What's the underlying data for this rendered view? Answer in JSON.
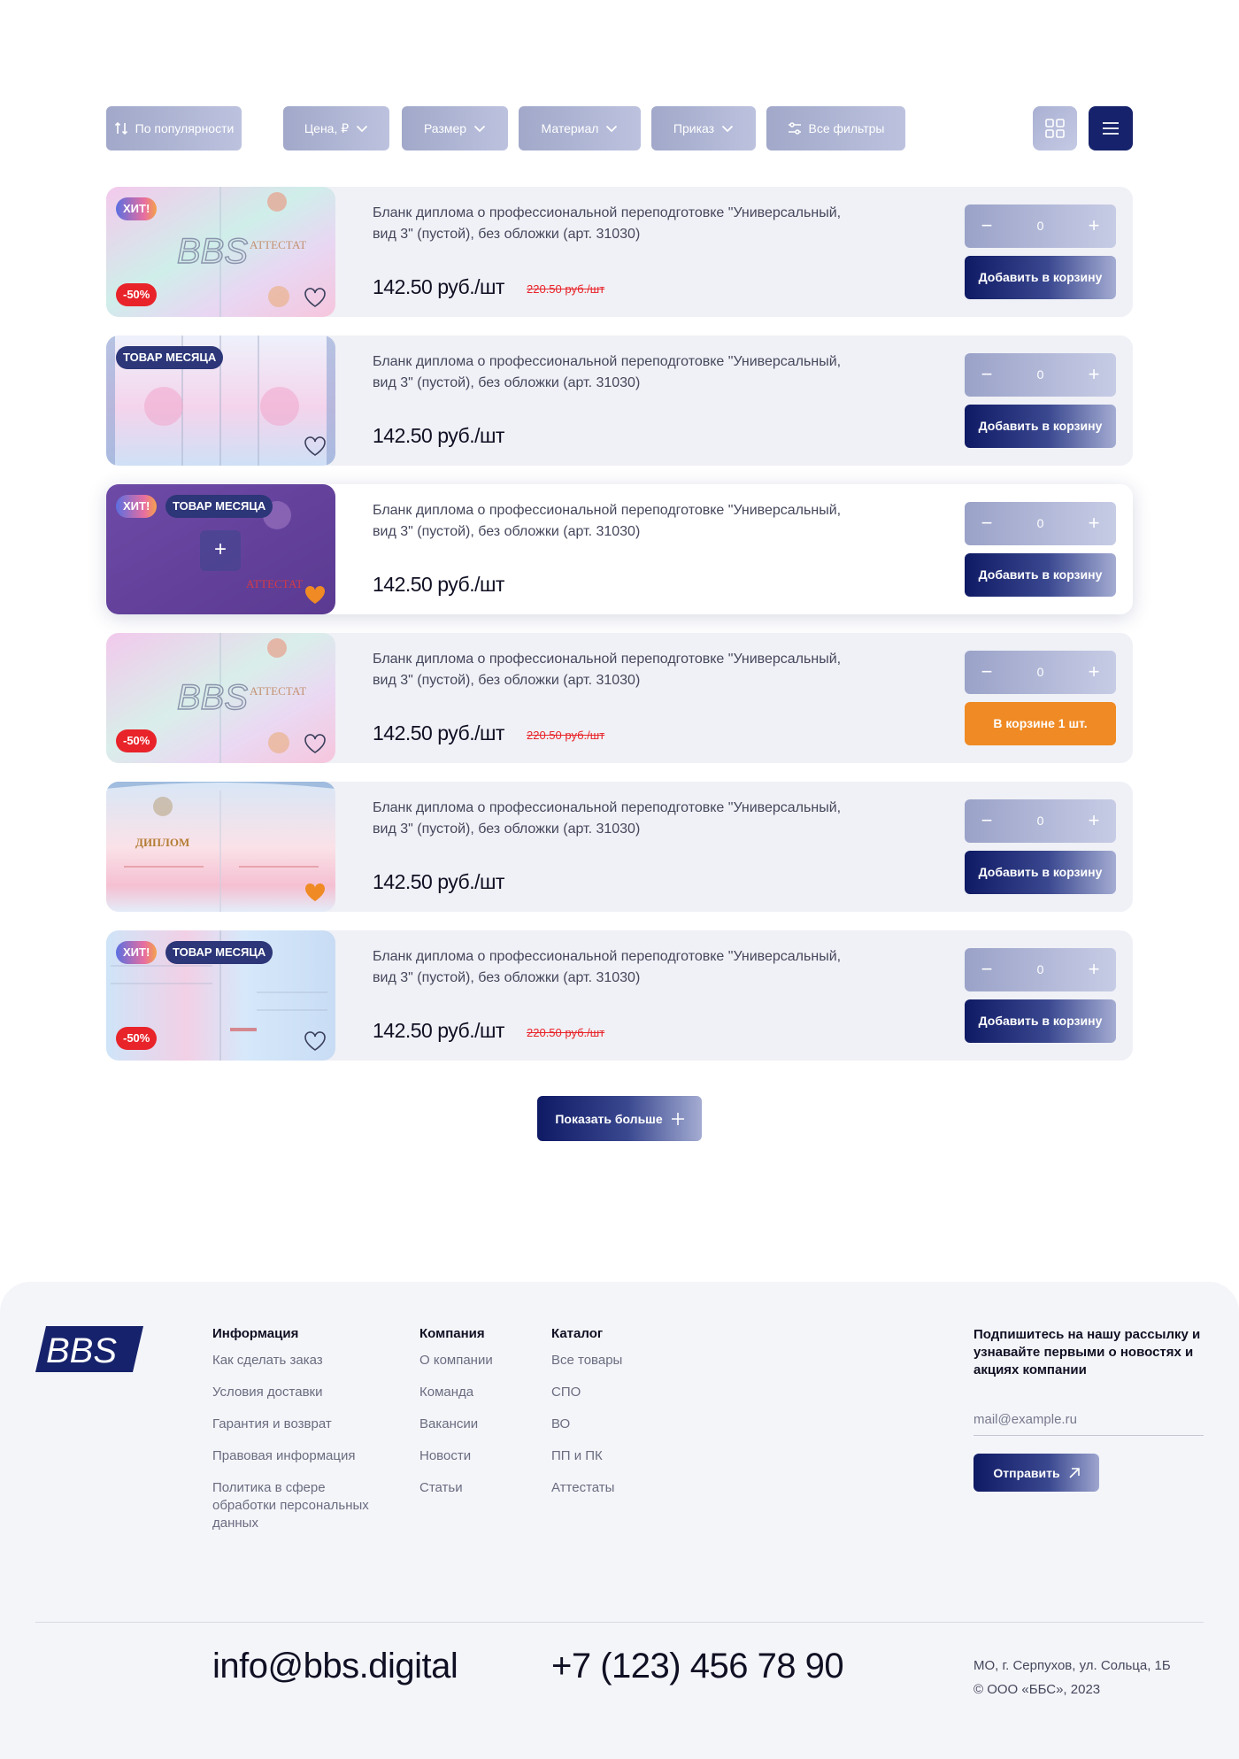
{
  "toolbar": {
    "sort_label": "По популярности",
    "filters": {
      "price": "Цена, ₽",
      "size": "Размер",
      "material": "Материал",
      "order": "Приказ",
      "all": "Все фильтры"
    }
  },
  "products": [
    {
      "title": "Бланк диплома о профессиональной переподготовке \"Универсальный, вид 3\" (пустой), без обложки (арт. 31030)",
      "price": "142.50 руб./шт",
      "old_price": "220.50 руб./шт",
      "badges": {
        "hit": "ХИТ!",
        "sale": "-50%"
      },
      "image_text": "АТТЕСТАТ",
      "qty": "0",
      "cart_label": "Добавить в корзину"
    },
    {
      "title": "Бланк диплома о профессиональной переподготовке \"Универсальный, вид 3\" (пустой), без обложки (арт. 31030)",
      "price": "142.50 руб./шт",
      "badges": {
        "month": "ТОВАР МЕСЯЦА"
      },
      "qty": "0",
      "cart_label": "Добавить в корзину"
    },
    {
      "title": "Бланк диплома о профессиональной переподготовке \"Универсальный, вид 3\" (пустой), без обложки (арт. 31030)",
      "price": "142.50 руб./шт",
      "badges": {
        "hit": "ХИТ!",
        "month": "ТОВАР МЕСЯЦА"
      },
      "image_text": "АТТЕСТАТ",
      "qty": "0",
      "cart_label": "Добавить в корзину"
    },
    {
      "title": "Бланк диплома о профессиональной переподготовке \"Универсальный, вид 3\" (пустой), без обложки (арт. 31030)",
      "price": "142.50 руб./шт",
      "old_price": "220.50 руб./шт",
      "badges": {
        "sale": "-50%"
      },
      "image_text": "АТТЕСТАТ",
      "qty": "0",
      "cart_label": "В корзине 1 шт."
    },
    {
      "title": "Бланк диплома о профессиональной переподготовке \"Универсальный, вид 3\" (пустой), без обложки (арт. 31030)",
      "price": "142.50 руб./шт",
      "badges": {},
      "image_text": "ДИПЛОМ",
      "qty": "0",
      "cart_label": "Добавить в корзину"
    },
    {
      "title": "Бланк диплома о профессиональной переподготовке \"Универсальный, вид 3\" (пустой), без обложки (арт. 31030)",
      "price": "142.50 руб./шт",
      "old_price": "220.50 руб./шт",
      "badges": {
        "hit": "ХИТ!",
        "month": "ТОВАР МЕСЯЦА",
        "sale": "-50%"
      },
      "qty": "0",
      "cart_label": "Добавить в корзину"
    }
  ],
  "load_more": "Показать больше",
  "footer": {
    "logo": "BBS",
    "info": {
      "title": "Информация",
      "links": [
        "Как сделать заказ",
        "Условия доставки",
        "Гарантия и возврат",
        "Правовая информация",
        "Политика в сфере обработки персональных данных"
      ]
    },
    "company": {
      "title": "Компания",
      "links": [
        "О компании",
        "Команда",
        "Вакансии",
        "Новости",
        "Статьи"
      ]
    },
    "catalog": {
      "title": "Каталог",
      "links": [
        "Все товары",
        "СПО",
        "ВО",
        "ПП и ПК",
        "Аттестаты"
      ]
    },
    "subscribe": {
      "title": "Подпишитесь на нашу рассылку и узнавайте первыми о новостях и акциях компании",
      "placeholder": "mail@example.ru",
      "button": "Отправить"
    },
    "email": "info@bbs.digital",
    "phone": "+7 (123) 456 78 90",
    "address": "МО, г. Серпухов, ул. Сольца, 1Б",
    "copyright": "© ООО «ББС», 2023"
  },
  "colors": {
    "navy": "#16226b",
    "orange": "#ef8a24",
    "sale_red": "#e8242a",
    "card_bg": "#f0f1f6"
  }
}
